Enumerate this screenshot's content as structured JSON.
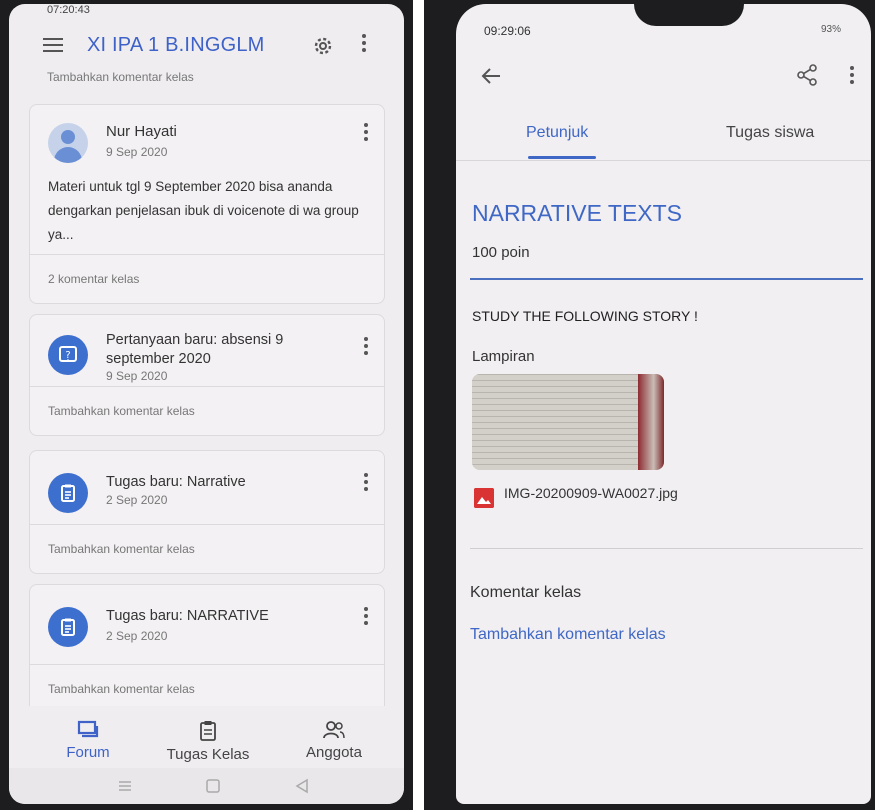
{
  "left": {
    "status_time": "07:20:43",
    "class_title": "XI IPA 1 B.INGGLM",
    "top_comment": "Tambahkan komentar kelas",
    "post": {
      "author": "Nur Hayati",
      "date": "9 Sep 2020",
      "text": "Materi untuk tgl 9 September 2020 bisa ananda dengarkan penjelasan ibuk di voicenote di wa group ya...",
      "comments": "2 komentar kelas"
    },
    "items": [
      {
        "title": "Pertanyaan baru: absensi 9 september 2020",
        "date": "9 Sep 2020",
        "comment": "Tambahkan komentar kelas",
        "icon": "question-icon"
      },
      {
        "title": "Tugas baru: Narrative",
        "date": "2 Sep 2020",
        "comment": "Tambahkan komentar kelas",
        "icon": "assignment-icon"
      },
      {
        "title": "Tugas baru: NARRATIVE",
        "date": "2 Sep 2020",
        "comment": "Tambahkan komentar kelas",
        "icon": "assignment-icon"
      }
    ],
    "nav": {
      "forum": "Forum",
      "tugas": "Tugas Kelas",
      "anggota": "Anggota"
    },
    "colors": {
      "accent": "#3e62c8"
    }
  },
  "right": {
    "status_time": "09:29:06",
    "battery": "93%",
    "tabs": {
      "petunjuk": "Petunjuk",
      "tugas_siswa": "Tugas siswa"
    },
    "assignment_title": "NARRATIVE TEXTS",
    "points": "100 poin",
    "instructions": "STUDY THE FOLLOWING  STORY !",
    "attachments_label": "Lampiran",
    "file_name": "IMG-20200909-WA0027.jpg",
    "comments_label": "Komentar kelas",
    "add_comment": "Tambahkan komentar kelas"
  }
}
